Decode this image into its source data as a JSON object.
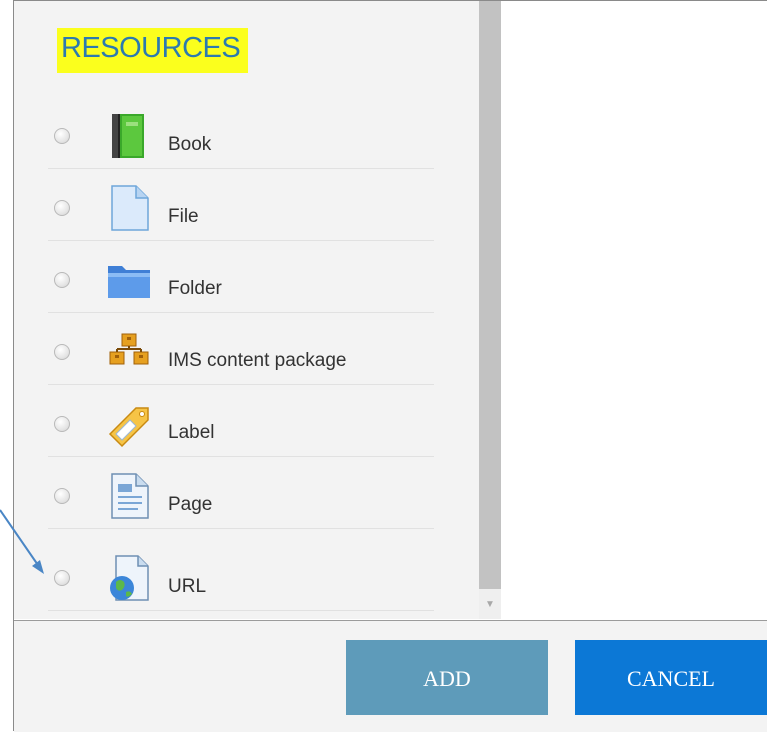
{
  "section_title": "RESOURCES",
  "items": [
    {
      "label": "Book",
      "icon": "book-icon"
    },
    {
      "label": "File",
      "icon": "file-icon"
    },
    {
      "label": "Folder",
      "icon": "folder-icon"
    },
    {
      "label": "IMS content package",
      "icon": "ims-package-icon"
    },
    {
      "label": "Label",
      "icon": "label-tag-icon"
    },
    {
      "label": "Page",
      "icon": "page-icon"
    },
    {
      "label": "URL",
      "icon": "url-globe-icon"
    }
  ],
  "buttons": {
    "add": "ADD",
    "cancel": "CANCEL"
  },
  "colors": {
    "highlight": "#fbff1d",
    "title_text": "#2c7ab0",
    "add_button": "#5e9bba",
    "cancel_button": "#0c78d6",
    "arrow": "#4a86c5"
  }
}
